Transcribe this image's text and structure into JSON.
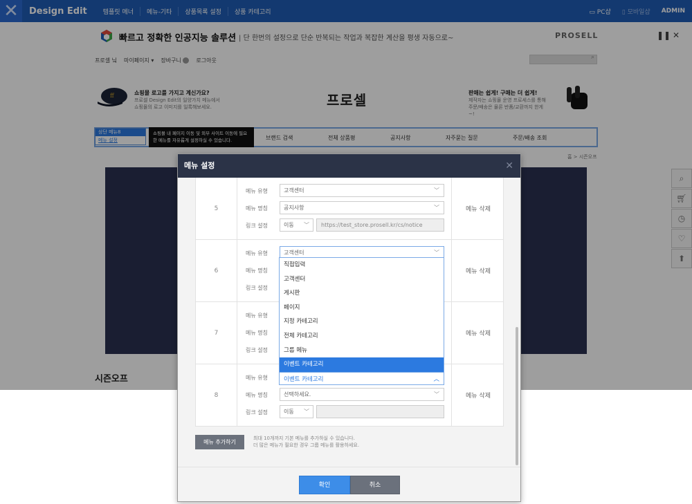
{
  "admin_bar": {
    "brand": "Design Edit",
    "menu": [
      "템플릿 메너",
      "메뉴-기타",
      "상품목록 설정",
      "상품 카테고리"
    ],
    "right": {
      "pc": "PC샵",
      "mobile": "모바일샵",
      "user": "ADMIN"
    }
  },
  "shop": {
    "tagline": "빠르고 정확한 인공지능 솔루션",
    "tagline_sub": "단 한번의 설정으로 단순 반복되는 작업과 복잡한 계산을 평생 자동으로~",
    "brand_logo": "PROSELL",
    "util_links": [
      "프로셀 닠",
      "마이페이지",
      "장바구니",
      "로그아웃"
    ],
    "banner_left_title": "쇼핑몰 로고를 가지고 계신가요?",
    "banner_left_sub": "프로셀 Design Edit의 일양가치 메뉴에서 쇼핑몰의 로고 이미지를 일록해보세요.",
    "site_title": "프로셀",
    "banner_right_title": "판매는 쉽게! 구매는 더 쉽게!",
    "banner_right_sub": "제작자는 쇼핑몰 운영 프로세스를 통해 주문/배송은 물론 반품/교환까지 한게~!",
    "nav_widget": {
      "top": "상단 메뉴8",
      "link": "메뉴 설정"
    },
    "tooltip": "쇼핑몰 내 페이지 이동 및 외부 사이트 이동에 필요한 메뉴를 자유롭게 설정하실 수 있습니다.",
    "nav_items": [
      "브랜드 검색",
      "전체 상품평",
      "공지사항",
      "자주묻는 질문",
      "주문/배송 조회"
    ],
    "breadcrumb": "홈 > 시즌오프",
    "section_title": "시즌오프"
  },
  "modal": {
    "title": "메뉴 설정",
    "labels": {
      "type": "메뉴 유형",
      "name": "메뉴 명칭",
      "link": "링크 설정"
    },
    "delete_label": "메뉴 삭제",
    "rows": [
      {
        "num": "5",
        "type": "고객센터",
        "name": "공지사항",
        "link_mode": "이동",
        "url": "https://test_store.prosell.kr/cs/notice"
      },
      {
        "num": "6",
        "type": "고객센터"
      },
      {
        "num": "7"
      },
      {
        "num": "8",
        "name": "선택하세요.",
        "link_mode": "이동",
        "url": ""
      }
    ],
    "dropdown_options": [
      "직접입력",
      "고객센터",
      "게시판",
      "페이지",
      "지정 카테고리",
      "전체 카테고리",
      "그룹 메뉴",
      "이벤트 카테고리"
    ],
    "dropdown_selected": "이벤트 카테고리",
    "add_button": "메뉴 추가하기",
    "add_note_1": "최대 10개까지 기본 메뉴를 추가하실 수 있습니다.",
    "add_note_2": "더 많은 메뉴가 필요한 경우 그룹 메뉴를 활용하세요.",
    "ok": "확인",
    "cancel": "취소"
  },
  "colors": {
    "admin_bar": "#1f5cb5",
    "primary": "#3d8de8",
    "modal_header": "#2b3347"
  }
}
